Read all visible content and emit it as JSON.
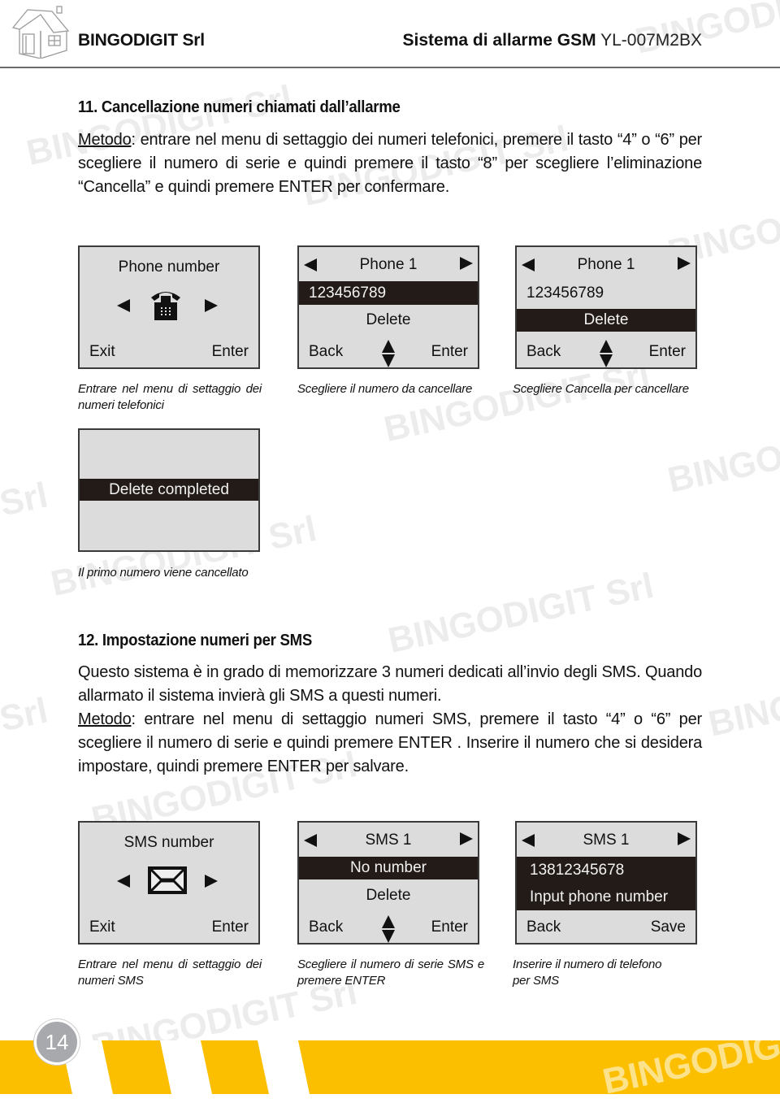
{
  "header": {
    "brand": "BINGODIGIT Srl",
    "doc_title_bold": "Sistema di allarme GSM",
    "doc_model": "YL-007M2BX"
  },
  "watermark": {
    "text_a": "BINGODIGIT Srl",
    "text_b": "BINGODIGIT",
    "text_c": "Srl"
  },
  "section11": {
    "title": "11. Cancellazione numeri chiamati dall’allarme",
    "method_label": "Metodo",
    "method_text": ": entrare nel menu di settaggio dei numeri telefonici, premere il tasto “4” o “6” per scegliere il numero di serie e quindi premere il tasto “8” per scegliere l’eliminazione “Cancella” e quindi premere ENTER per confermare.",
    "screens": [
      {
        "title": "Phone number",
        "icon": "telephone-icon",
        "left_softkey": "Exit",
        "right_softkey": "Enter",
        "caption": "Entrare nel menu di settaggio dei numeri telefonici"
      },
      {
        "title": "Phone 1",
        "line1": "123456789",
        "line2": "Delete",
        "highlighted": "line1",
        "left_softkey": "Back",
        "right_softkey": "Enter",
        "caption": "Scegliere il numero da cancellare"
      },
      {
        "title": "Phone 1",
        "line1": "123456789",
        "line2": "Delete",
        "highlighted": "line2",
        "left_softkey": "Back",
        "right_softkey": "Enter",
        "caption": "Scegliere Cancella per cancellare"
      },
      {
        "message": "Delete completed",
        "caption": "Il primo numero viene cancellato"
      }
    ]
  },
  "section12": {
    "title": "12. Impostazione numeri per SMS",
    "intro": "Questo sistema è in grado di memorizzare 3 numeri dedicati all’invio degli SMS. Quando allarmato il sistema invierà gli SMS a questi numeri.",
    "method_label": "Metodo",
    "method_text": ": entrare nel menu di settaggio numeri SMS, premere il tasto “4” o “6” per scegliere il numero di serie e quindi premere ENTER . Inserire il numero che si desidera impostare, quindi premere ENTER per salvare.",
    "screens": [
      {
        "title": "SMS number",
        "icon": "envelope-icon",
        "left_softkey": "Exit",
        "right_softkey": "Enter",
        "caption": "Entrare nel menu di settaggio dei numeri SMS"
      },
      {
        "title": "SMS 1",
        "line1": "No number",
        "line2": "Delete",
        "highlighted": "line1",
        "left_softkey": "Back",
        "right_softkey": "Enter",
        "caption": "Scegliere il numero di serie SMS e premere ENTER"
      },
      {
        "title": "SMS 1",
        "line1": "13812345678",
        "line2": "Input  phone number",
        "highlighted": "both",
        "left_softkey": "Back",
        "right_softkey": "Save",
        "caption": "Inserire il numero di telefono per SMS"
      }
    ]
  },
  "footer": {
    "page_number": "14",
    "accent_color": "#fbbf00"
  }
}
